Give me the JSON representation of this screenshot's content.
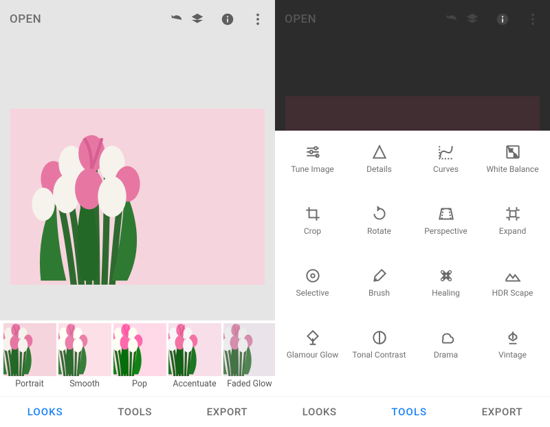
{
  "left": {
    "open_label": "OPEN",
    "looks": [
      {
        "label": "Portrait"
      },
      {
        "label": "Smooth"
      },
      {
        "label": "Pop"
      },
      {
        "label": "Accentuate"
      },
      {
        "label": "Faded Glow"
      }
    ],
    "tabs": {
      "looks": "LOOKS",
      "tools": "TOOLS",
      "export": "EXPORT"
    }
  },
  "right": {
    "open_label": "OPEN",
    "tools": [
      {
        "label": "Tune Image",
        "icon": "tune"
      },
      {
        "label": "Details",
        "icon": "details"
      },
      {
        "label": "Curves",
        "icon": "curves"
      },
      {
        "label": "White Balance",
        "icon": "whitebalance"
      },
      {
        "label": "Crop",
        "icon": "crop"
      },
      {
        "label": "Rotate",
        "icon": "rotate"
      },
      {
        "label": "Perspective",
        "icon": "perspective"
      },
      {
        "label": "Expand",
        "icon": "expand"
      },
      {
        "label": "Selective",
        "icon": "selective"
      },
      {
        "label": "Brush",
        "icon": "brush"
      },
      {
        "label": "Healing",
        "icon": "healing"
      },
      {
        "label": "HDR Scape",
        "icon": "hdr"
      },
      {
        "label": "Glamour Glow",
        "icon": "glamour"
      },
      {
        "label": "Tonal Contrast",
        "icon": "tonal"
      },
      {
        "label": "Drama",
        "icon": "drama"
      },
      {
        "label": "Vintage",
        "icon": "vintage"
      }
    ],
    "tabs": {
      "looks": "LOOKS",
      "tools": "TOOLS",
      "export": "EXPORT"
    }
  }
}
